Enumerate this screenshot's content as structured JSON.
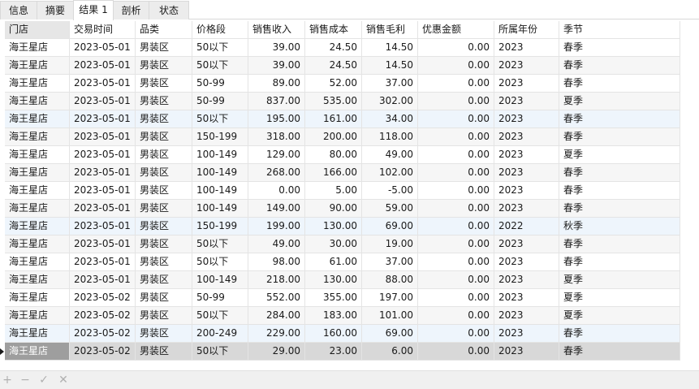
{
  "tabs": [
    {
      "label": "信息",
      "active": false
    },
    {
      "label": "摘要",
      "active": false
    },
    {
      "label": "结果 1",
      "active": true
    },
    {
      "label": "剖析",
      "active": false
    },
    {
      "label": "状态",
      "active": false
    }
  ],
  "table": {
    "columns": [
      "门店",
      "交易时间",
      "品类",
      "价格段",
      "销售收入",
      "销售成本",
      "销售毛利",
      "优惠金额",
      "所属年份",
      "季节"
    ],
    "rows": [
      [
        "海王星店",
        "2023-05-01",
        "男装区",
        "50以下",
        "39.00",
        "24.50",
        "14.50",
        "0.00",
        "2023",
        "春季"
      ],
      [
        "海王星店",
        "2023-05-01",
        "男装区",
        "50以下",
        "39.00",
        "24.50",
        "14.50",
        "0.00",
        "2023",
        "春季"
      ],
      [
        "海王星店",
        "2023-05-01",
        "男装区",
        "50-99",
        "89.00",
        "52.00",
        "37.00",
        "0.00",
        "2023",
        "春季"
      ],
      [
        "海王星店",
        "2023-05-01",
        "男装区",
        "50-99",
        "837.00",
        "535.00",
        "302.00",
        "0.00",
        "2023",
        "夏季"
      ],
      [
        "海王星店",
        "2023-05-01",
        "男装区",
        "50以下",
        "195.00",
        "161.00",
        "34.00",
        "0.00",
        "2023",
        "春季"
      ],
      [
        "海王星店",
        "2023-05-01",
        "男装区",
        "150-199",
        "318.00",
        "200.00",
        "118.00",
        "0.00",
        "2023",
        "春季"
      ],
      [
        "海王星店",
        "2023-05-01",
        "男装区",
        "100-149",
        "129.00",
        "80.00",
        "49.00",
        "0.00",
        "2023",
        "夏季"
      ],
      [
        "海王星店",
        "2023-05-01",
        "男装区",
        "100-149",
        "268.00",
        "166.00",
        "102.00",
        "0.00",
        "2023",
        "春季"
      ],
      [
        "海王星店",
        "2023-05-01",
        "男装区",
        "100-149",
        "0.00",
        "5.00",
        "-5.00",
        "0.00",
        "2023",
        "春季"
      ],
      [
        "海王星店",
        "2023-05-01",
        "男装区",
        "100-149",
        "149.00",
        "90.00",
        "59.00",
        "0.00",
        "2023",
        "春季"
      ],
      [
        "海王星店",
        "2023-05-01",
        "男装区",
        "150-199",
        "199.00",
        "130.00",
        "69.00",
        "0.00",
        "2022",
        "秋季"
      ],
      [
        "海王星店",
        "2023-05-01",
        "男装区",
        "50以下",
        "49.00",
        "30.00",
        "19.00",
        "0.00",
        "2023",
        "春季"
      ],
      [
        "海王星店",
        "2023-05-01",
        "男装区",
        "50以下",
        "98.00",
        "61.00",
        "37.00",
        "0.00",
        "2023",
        "春季"
      ],
      [
        "海王星店",
        "2023-05-01",
        "男装区",
        "100-149",
        "218.00",
        "130.00",
        "88.00",
        "0.00",
        "2023",
        "夏季"
      ],
      [
        "海王星店",
        "2023-05-02",
        "男装区",
        "50-99",
        "552.00",
        "355.00",
        "197.00",
        "0.00",
        "2023",
        "夏季"
      ],
      [
        "海王星店",
        "2023-05-02",
        "男装区",
        "50以下",
        "284.00",
        "183.00",
        "101.00",
        "0.00",
        "2023",
        "夏季"
      ],
      [
        "海王星店",
        "2023-05-02",
        "男装区",
        "200-249",
        "229.00",
        "160.00",
        "69.00",
        "0.00",
        "2023",
        "春季"
      ],
      [
        "海王星店",
        "2023-05-02",
        "男装区",
        "50以下",
        "29.00",
        "23.00",
        "6.00",
        "0.00",
        "2023",
        "春季"
      ]
    ]
  },
  "bottom_toolbar": {
    "add_label": "+",
    "delete_label": "−",
    "apply_label": "✓",
    "cancel_label": "✕"
  }
}
